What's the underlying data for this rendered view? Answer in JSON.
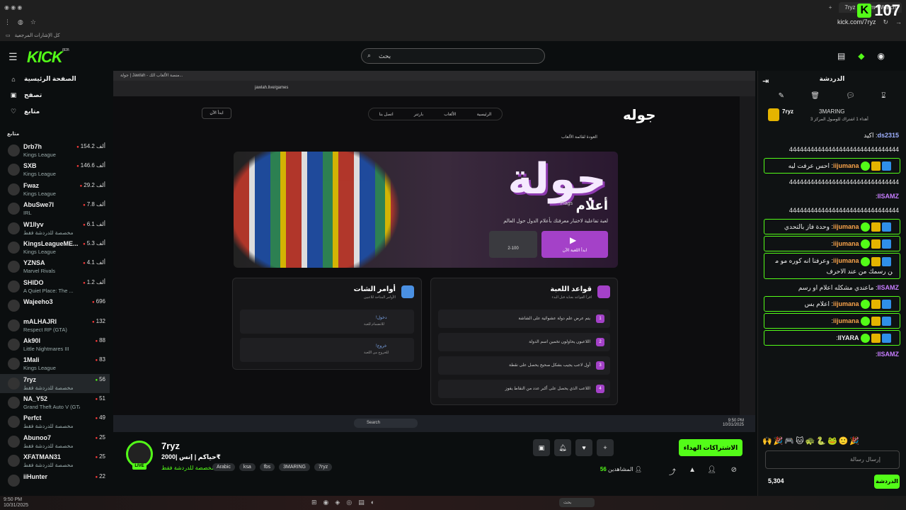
{
  "browser": {
    "tab_title": "7ryz Stream - Watch",
    "url": "kick.com/7ryz",
    "bookmarks_label": "كل الإشارات المرجعية",
    "count_badge": "107"
  },
  "header": {
    "logo": "KICK",
    "logo_tag": "BETA",
    "search_placeholder": "بحث"
  },
  "sidebar": {
    "nav": [
      "الصفحة الرئيسية",
      "تصفح",
      "متابع"
    ],
    "followed_label": "متابع",
    "channels": [
      {
        "name": "Drb7h",
        "game": "Kings League",
        "viewers": "154.2 ألف"
      },
      {
        "name": "SXB",
        "game": "Kings League",
        "viewers": "146.6 ألف"
      },
      {
        "name": "Fwaz",
        "game": "Kings League",
        "viewers": "29.2 ألف"
      },
      {
        "name": "AbuSwe7l",
        "game": "IRL",
        "viewers": "7.8 ألف"
      },
      {
        "name": "W1llyv",
        "game": "مخصصة للدردشة فقط",
        "viewers": "6.1 ألف"
      },
      {
        "name": "KingsLeagueME...",
        "game": "Kings League",
        "viewers": "5.3 ألف"
      },
      {
        "name": "YZNSA",
        "game": "Marvel Rivals",
        "viewers": "4.1 ألف"
      },
      {
        "name": "SHIDO",
        "game": "A Quiet Place: The ...",
        "viewers": "1.2 ألف"
      },
      {
        "name": "Wajeeho3",
        "game": "",
        "viewers": "696"
      },
      {
        "name": "mALHAJRI",
        "game": "Respect RP (GTA)",
        "viewers": "132"
      },
      {
        "name": "Ak90I",
        "game": "Little Nightmares III",
        "viewers": "88"
      },
      {
        "name": "1Mali",
        "game": "Kings League",
        "viewers": "83"
      },
      {
        "name": "7ryz",
        "game": "مخصصة للدردشة فقط",
        "viewers": "56"
      },
      {
        "name": "NA_Y52",
        "game": "Grand Theft Auto V (GTA)",
        "viewers": "51"
      },
      {
        "name": "Perfct",
        "game": "مخصصة للدردشة فقط",
        "viewers": "49"
      },
      {
        "name": "Abunoo7",
        "game": "مخصصة للدردشة فقط",
        "viewers": "25"
      },
      {
        "name": "XFATMAN31",
        "game": "مخصصة للدردشة فقط",
        "viewers": "25"
      },
      {
        "name": "iiHunter",
        "game": "",
        "viewers": "22"
      }
    ]
  },
  "video": {
    "inner_tab": "جولة | Jawlah - منصة الألعاب الك...",
    "inner_url": "jawlah.live/games",
    "site_logo": "جوله",
    "nav": [
      "الرئيسية",
      "الألعاب",
      "بارتنر",
      "اتصل بنا"
    ],
    "start_btn": "ابدأ الآن",
    "back_link": "العودة لقائمة الألعاب",
    "hero_title": "جولة",
    "hero_flags_ar": "أعلام",
    "hero_flags_en": "Flags",
    "hero_desc": "لعبة تفاعلية لاختبار معرفتك بأعلام الدول حول العالم",
    "players_label": "عدد اللاعبين",
    "players_range": "2-100",
    "play_btn": "ابدأ اللعبة الآن",
    "rules_title": "قواعد اللعبة",
    "rules_sub": "اقرأ القواعد بعناية قبل البدء",
    "rules": [
      "يتم عرض علم دولة عشوائية على الشاشة",
      "اللاعبون يحاولون تخمين اسم الدولة",
      "أول لاعب يجيب بشكل صحيح يحصل على نقطة",
      "اللاعب الذي يحصل على أكبر عدد من النقاط يفوز"
    ],
    "commands_title": "أوامر الشات",
    "commands_sub": "الأوامر المتاحة للاعبين",
    "commands": [
      {
        "cmd": "!دخول",
        "desc": "للانضمام للعبة"
      },
      {
        "cmd": "!خروج",
        "desc": "للخروج من اللعبة"
      }
    ],
    "taskbar_search": "Search",
    "clock_time": "9:50 PM",
    "clock_date": "10/31/2025"
  },
  "stream": {
    "name": "7ryz",
    "title": "حياكم | إنس |2000₹",
    "category": "مخصصة للدردشة فقط",
    "tags": [
      "Arabic",
      "ksa",
      "fbs",
      "3MARING",
      "7ryz"
    ],
    "live": "LIVE",
    "subscribe": "الاشتراكات الهداء",
    "viewers_count": "56",
    "viewers_label": "المشاهدين"
  },
  "chat": {
    "title": "الدردشة",
    "pinned_user": "7ryz",
    "pinned_other": "3MARING",
    "pinned_text": "أهداء 1 اشتراك للوصول المركز 3",
    "messages": [
      {
        "user": "ds2315",
        "text": "اكيد",
        "color": "#9fb0ff",
        "hl": false
      },
      {
        "user": "",
        "text": "4444444444444444444444444444444",
        "color": "#eee",
        "hl": false
      },
      {
        "user": "iijumana",
        "text": "احس عرفت ليه",
        "color": "#f7a24a",
        "hl": true
      },
      {
        "user": "",
        "text": "4444444444444444444444444444444",
        "color": "#eee",
        "hl": false
      },
      {
        "user": "IISAMZ",
        "text": "",
        "color": "#c77dff",
        "hl": false
      },
      {
        "user": "",
        "text": "4444444444444444444444444444444",
        "color": "#eee",
        "hl": false
      },
      {
        "user": "iijumana",
        "text": "وحدة فاز بالتحدي",
        "color": "#f7a24a",
        "hl": true
      },
      {
        "user": "iijumana",
        "text": "",
        "color": "#f7a24a",
        "hl": true
      },
      {
        "user": "iijumana",
        "text": "وعرفنا انه كوره مو من رسمك من عند الاحرف",
        "color": "#f7a24a",
        "hl": true
      },
      {
        "user": "IISAMZ",
        "text": "ماعندي مشكله اعلام او رسم",
        "color": "#c77dff",
        "hl": false
      },
      {
        "user": "iijumana",
        "text": "اعلام بس",
        "color": "#f7a24a",
        "hl": true
      },
      {
        "user": "iijumana",
        "text": "",
        "color": "#f7a24a",
        "hl": true
      },
      {
        "user": "IIYARA",
        "text": "",
        "color": "#eee",
        "hl": true
      },
      {
        "user": "IISAMZ",
        "text": "",
        "color": "#c77dff",
        "hl": false
      }
    ],
    "input_placeholder": "إرسال رسالة",
    "points": "5,304",
    "send": "الدردشة"
  },
  "os": {
    "time": "9:50 PM",
    "date": "10/31/2025",
    "search": "بحث"
  },
  "colors": {
    "accent": "#53fc18",
    "purple": "#a441c8"
  }
}
